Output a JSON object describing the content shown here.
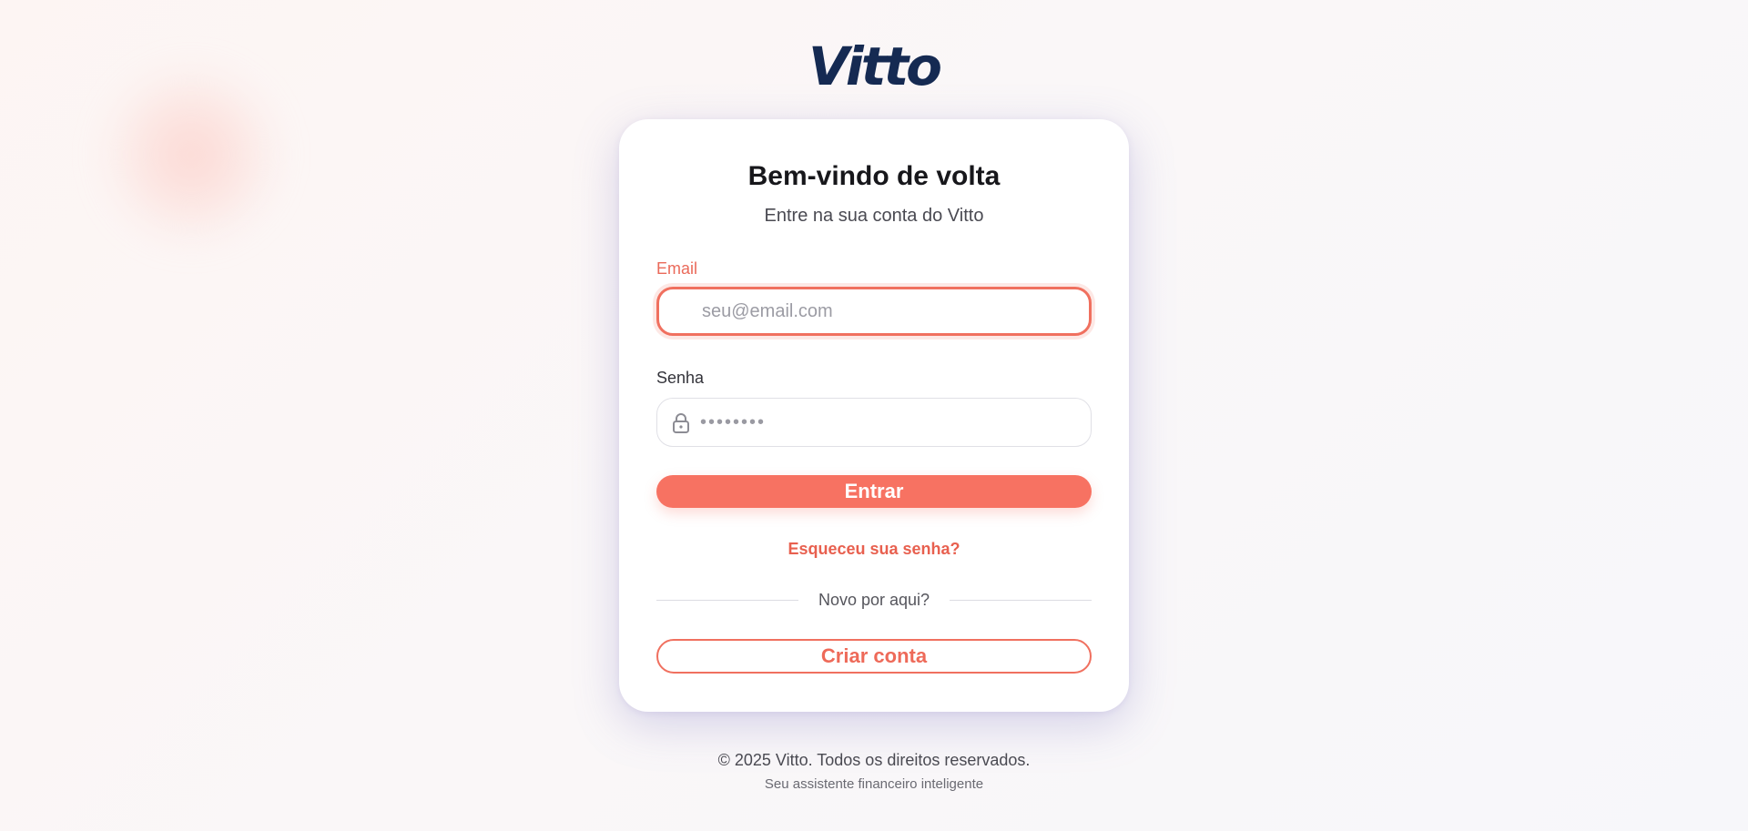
{
  "brand": {
    "logo_text": "Vitto",
    "accent_color": "#f77262",
    "logo_color": "#152a52"
  },
  "login": {
    "title": "Bem-vindo de volta",
    "subtitle": "Entre na sua conta do Vitto",
    "email": {
      "label": "Email",
      "placeholder": "seu@email.com",
      "value": ""
    },
    "password": {
      "label": "Senha",
      "placeholder": "••••••••",
      "value": "",
      "icon": "lock-icon"
    },
    "submit_label": "Entrar",
    "forgot_password_label": "Esqueceu sua senha?",
    "divider_text": "Novo por aqui?",
    "create_account_label": "Criar conta"
  },
  "footer": {
    "copyright": "© 2025 Vitto. Todos os direitos reservados.",
    "tagline": "Seu assistente financeiro inteligente"
  }
}
